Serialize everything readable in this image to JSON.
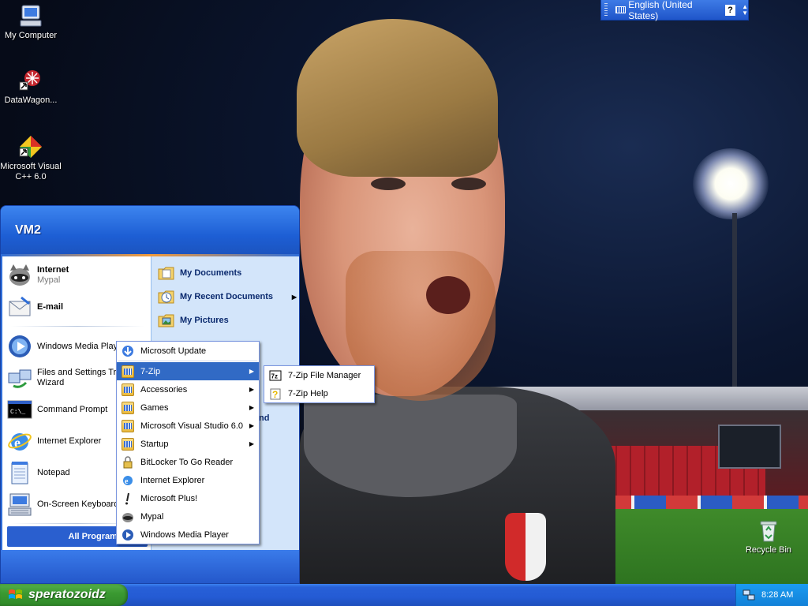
{
  "desktop": {
    "icons": [
      {
        "label": "My Computer"
      },
      {
        "label": "DataWagon..."
      },
      {
        "label": "Microsoft Visual C++ 6.0"
      },
      {
        "label": "Recycle Bin"
      }
    ]
  },
  "language_bar": {
    "language": "English (United States)",
    "help_glyph": "?"
  },
  "start_menu": {
    "user_name": "VM2",
    "pinned": [
      {
        "title": "Internet",
        "subtitle": "Mypal"
      },
      {
        "title": "E-mail",
        "subtitle": ""
      }
    ],
    "recent": [
      {
        "label": "Windows Media Player"
      },
      {
        "label": "Files and Settings Transfer Wizard"
      },
      {
        "label": "Command Prompt"
      },
      {
        "label": "Internet Explorer"
      },
      {
        "label": "Notepad"
      },
      {
        "label": "On-Screen Keyboard"
      }
    ],
    "all_programs_label": "All Programs",
    "places": [
      {
        "label": "My Documents"
      },
      {
        "label": "My Recent Documents"
      },
      {
        "label": "My Pictures"
      }
    ],
    "partial_right_text": "nd"
  },
  "programs_menu": {
    "items": [
      {
        "label": "Microsoft Update"
      },
      {
        "label": "7-Zip"
      },
      {
        "label": "Accessories"
      },
      {
        "label": "Games"
      },
      {
        "label": "Microsoft Visual Studio 6.0"
      },
      {
        "label": "Startup"
      },
      {
        "label": "BitLocker To Go Reader"
      },
      {
        "label": "Internet Explorer"
      },
      {
        "label": "Microsoft Plus!"
      },
      {
        "label": "Mypal"
      },
      {
        "label": "Windows Media Player"
      }
    ]
  },
  "zip_submenu": {
    "items": [
      {
        "label": "7-Zip File Manager"
      },
      {
        "label": "7-Zip Help"
      }
    ]
  },
  "taskbar": {
    "start_label": "speratozoidz",
    "clock": "8:28 AM"
  }
}
